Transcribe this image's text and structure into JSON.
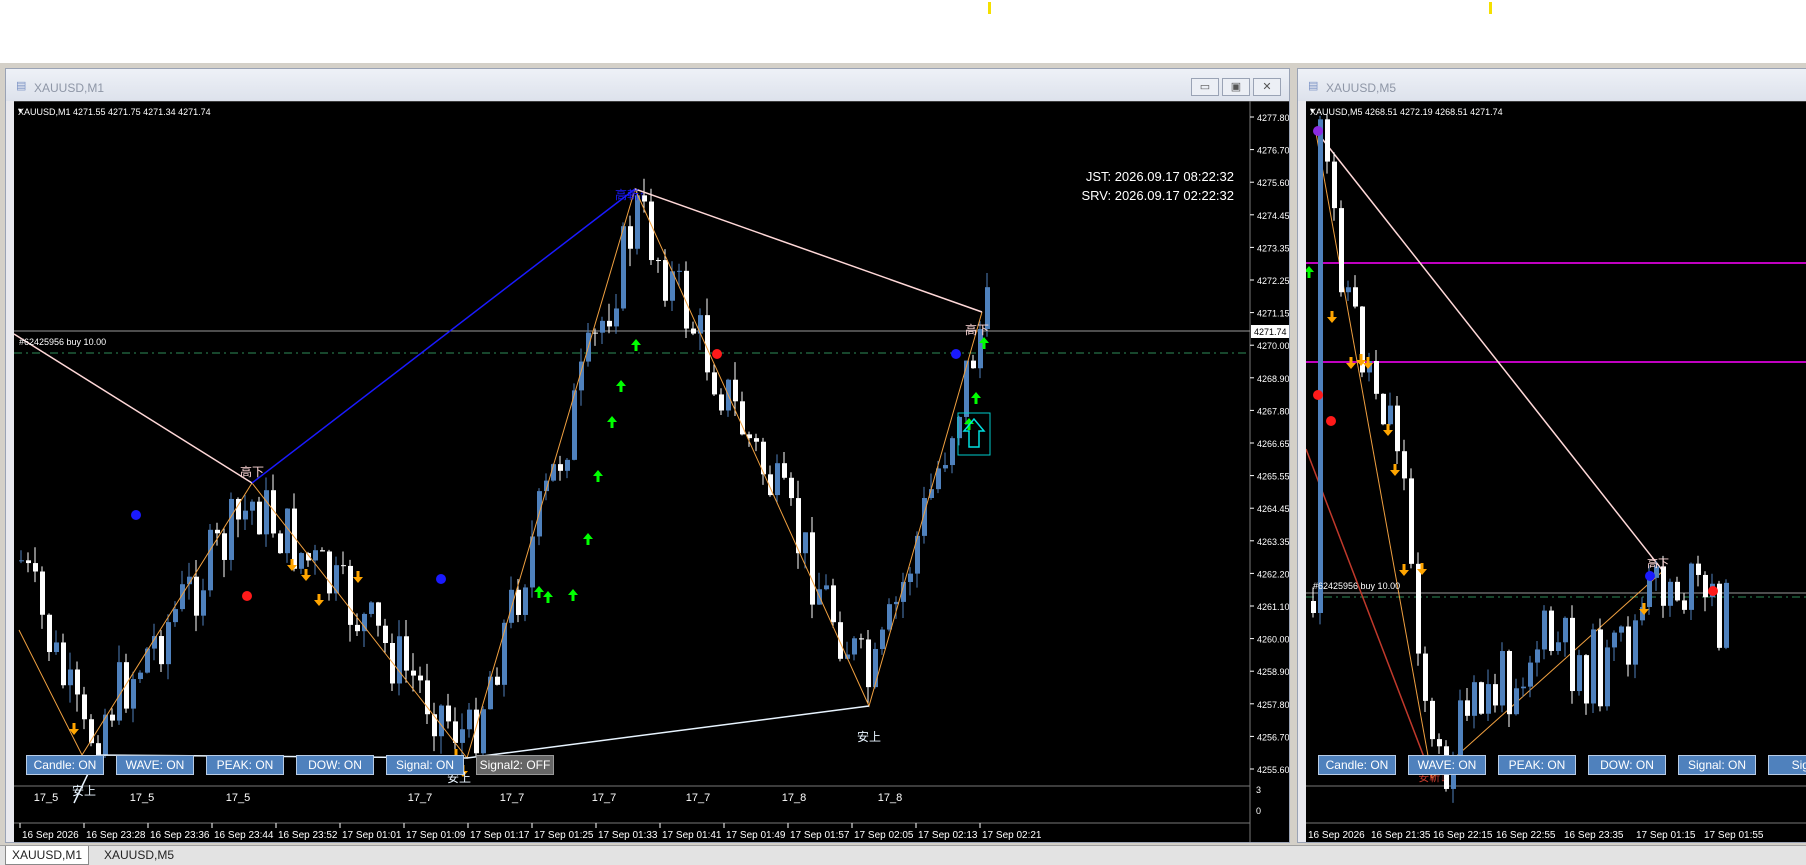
{
  "window_left": {
    "title": "XAUUSD,M1",
    "header": "XAUUSD,M1 4271.55 4271.75 4271.34 4271.74",
    "clock_jst": "JST: 2026.09.17 08:22:32",
    "clock_srv": "SRV: 2026.09.17 02:22:32",
    "order_label": "#62425956 buy 10.00",
    "current_price": "4271.74",
    "price_axis": [
      "4277.80",
      "4276.70",
      "4275.60",
      "4274.45",
      "4273.35",
      "4272.25",
      "4271.15",
      "4270.00",
      "4268.90",
      "4267.80",
      "4266.65",
      "4265.55",
      "4264.45",
      "4263.35",
      "4262.20",
      "4261.10",
      "4260.00",
      "4258.90",
      "4257.80",
      "4256.70",
      "4255.60"
    ],
    "period_labels": [
      "17_5",
      "17_5",
      "17_5",
      "17_7",
      "17_7",
      "17_7",
      "17_7",
      "17_8",
      "17_8"
    ],
    "time_axis": [
      "16 Sep 2026",
      "16 Sep 23:28",
      "16 Sep 23:36",
      "16 Sep 23:44",
      "16 Sep 23:52",
      "17 Sep 01:01",
      "17 Sep 01:09",
      "17 Sep 01:17",
      "17 Sep 01:25",
      "17 Sep 01:33",
      "17 Sep 01:41",
      "17 Sep 01:49",
      "17 Sep 01:57",
      "17 Sep 02:05",
      "17 Sep 02:13",
      "17 Sep 02:21"
    ],
    "sub_axis": [
      "3",
      "0"
    ],
    "peak_labels": {
      "high_break": "高斬↑",
      "high_down_1": "高下",
      "high_down_2": "高下",
      "low_up_1": "安上",
      "low_up_2": "安上",
      "low_up_3": "安上"
    },
    "buttons": [
      {
        "label": "Candle: ON",
        "on": true
      },
      {
        "label": "WAVE: ON",
        "on": true
      },
      {
        "label": "PEAK: ON",
        "on": true
      },
      {
        "label": "DOW: ON",
        "on": true
      },
      {
        "label": "Signal: ON",
        "on": true
      },
      {
        "label": "Signal2: OFF",
        "on": false
      }
    ]
  },
  "window_right": {
    "title": "XAUUSD,M5",
    "header": "XAUUSD,M5 4268.51 4272.19 4268.51 4271.74",
    "order_label": "#62425956 buy 10.00",
    "peak_labels": {
      "high_down": "高下",
      "low_break": "安斬↓"
    },
    "time_axis": [
      "16 Sep 2026",
      "16 Sep 21:35",
      "16 Sep 22:15",
      "16 Sep 22:55",
      "16 Sep 23:35",
      "17 Sep 01:15",
      "17 Sep 01:55"
    ],
    "buttons": [
      {
        "label": "Candle: ON",
        "on": true
      },
      {
        "label": "WAVE: ON",
        "on": true
      },
      {
        "label": "PEAK: ON",
        "on": true
      },
      {
        "label": "DOW: ON",
        "on": true
      },
      {
        "label": "Signal: ON",
        "on": true
      },
      {
        "label": "Signa",
        "on": true
      }
    ]
  },
  "tabs": [
    "XAUUSD,M1",
    "XAUUSD,M5"
  ],
  "colors": {
    "bull": "#4f81bd",
    "bear": "#ffffff",
    "wave": "#f0a040",
    "dow_up": "#1a1aff",
    "dow_down": "#ffd8d8",
    "signal_up": "#00ff00",
    "signal_down": "#ffa500",
    "magenta": "#ff00ff"
  }
}
